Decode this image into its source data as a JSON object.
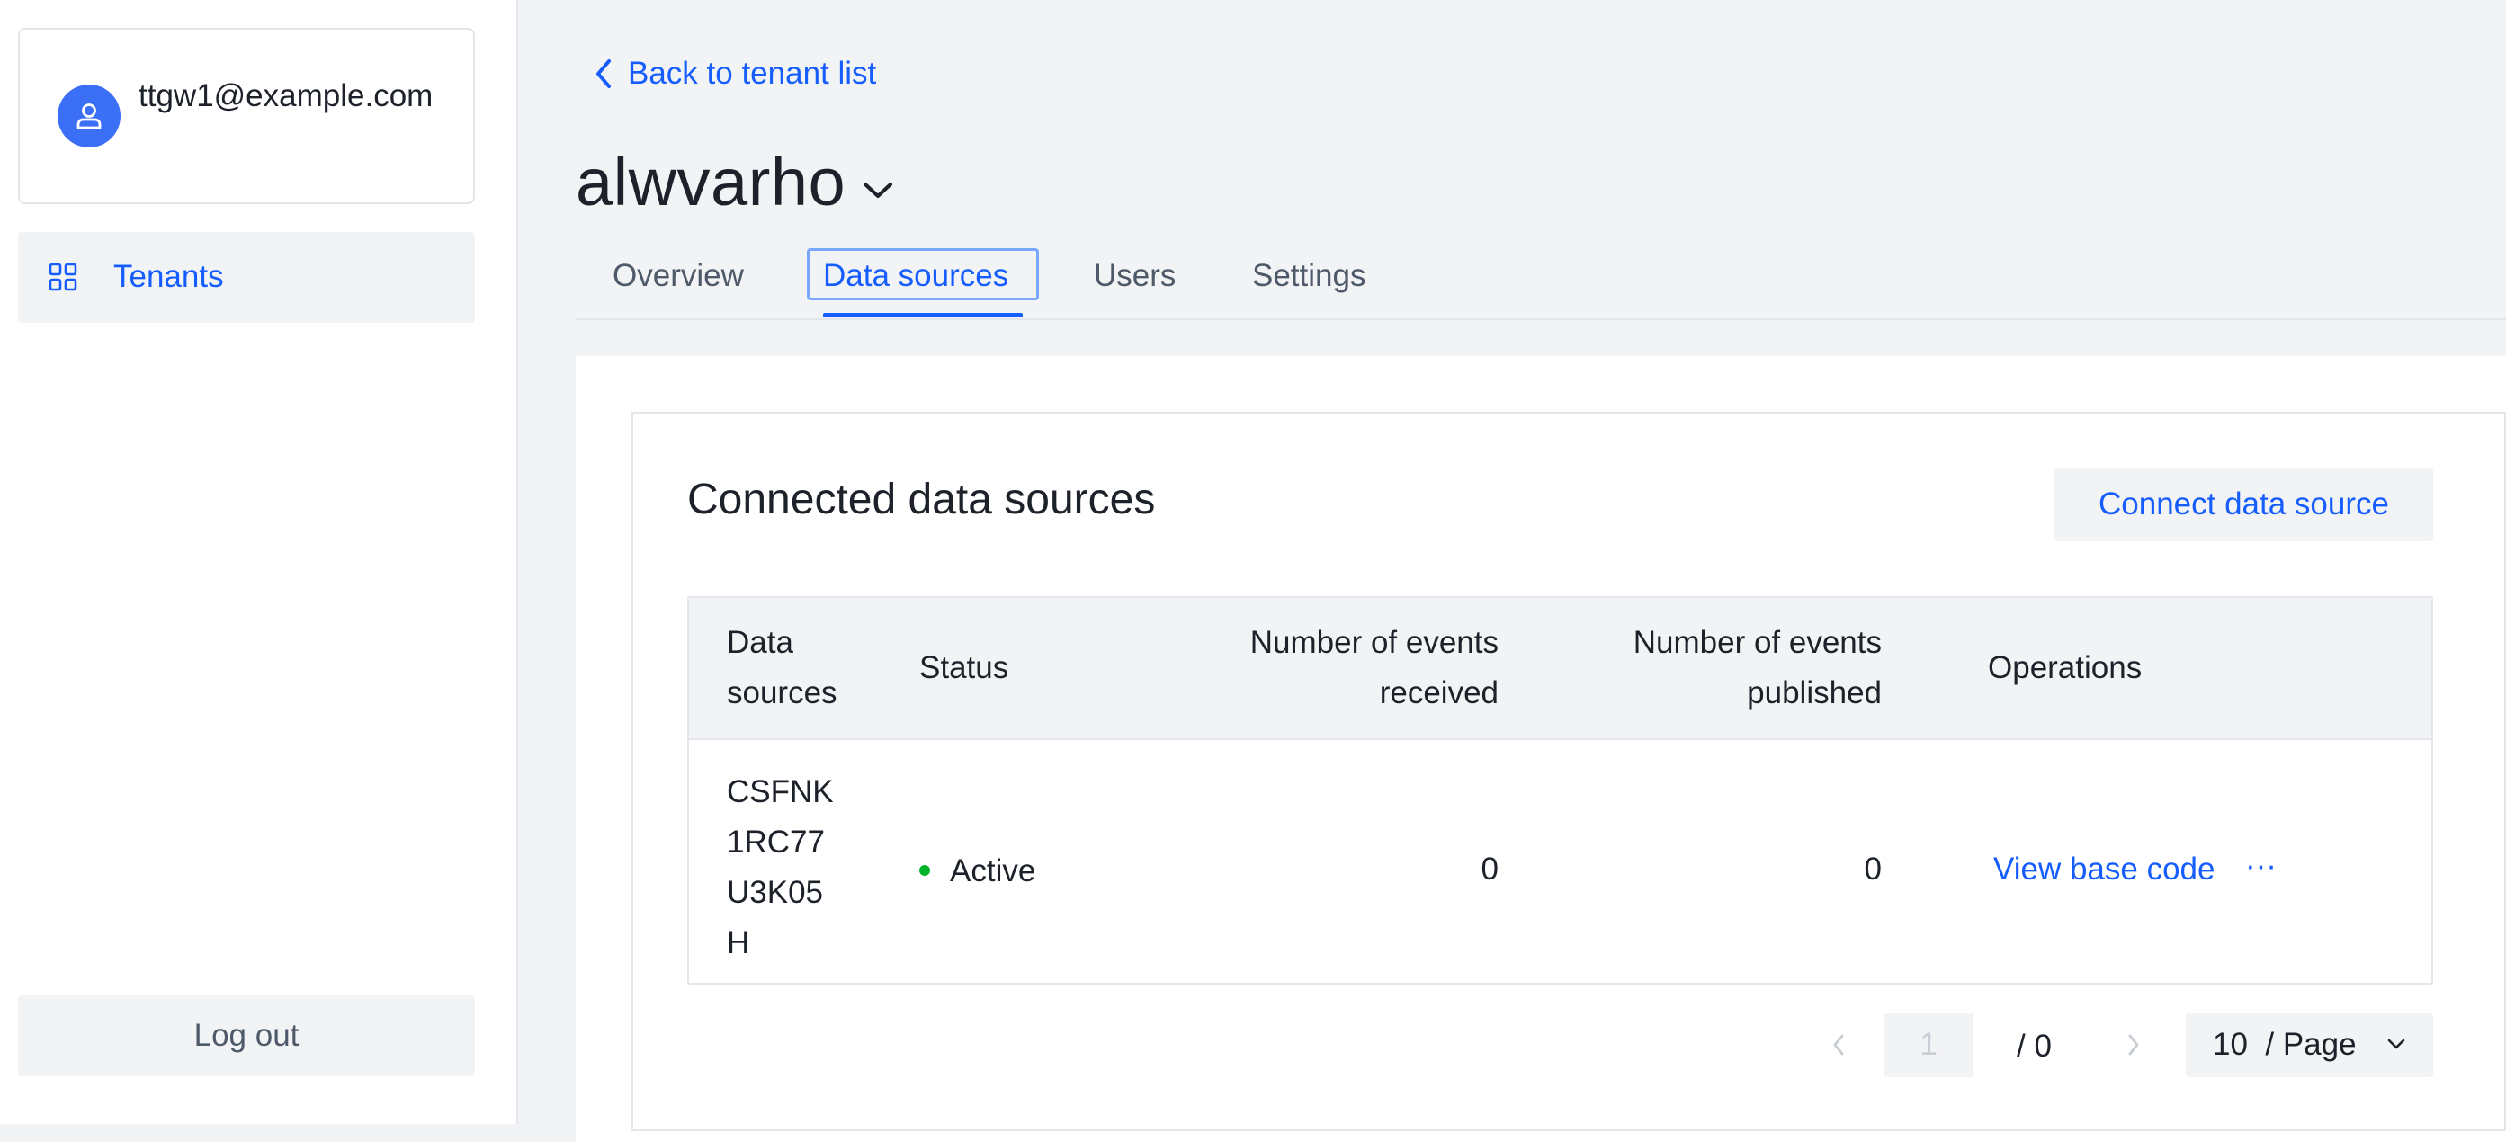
{
  "sidebar": {
    "user_email": "ttgw1@example.com",
    "nav_items": [
      {
        "label": "Tenants",
        "icon": "grid-icon"
      }
    ],
    "logout_label": "Log out"
  },
  "header": {
    "back_label": "Back to tenant list",
    "tenant_name": "alwvarho"
  },
  "tabs": [
    {
      "label": "Overview"
    },
    {
      "label": "Data sources",
      "active": true
    },
    {
      "label": "Users"
    },
    {
      "label": "Settings"
    }
  ],
  "card": {
    "title": "Connected data sources",
    "connect_label": "Connect data source"
  },
  "table": {
    "columns": [
      "Data sources",
      "Status",
      "Number of events received",
      "Number of events published",
      "Operations"
    ],
    "rows": [
      {
        "data_source": "CSFNK1RC77U3K05H",
        "status": "Active",
        "events_received": "0",
        "events_published": "0",
        "operation_link": "View base code",
        "operation_more": "···"
      }
    ]
  },
  "pagination": {
    "current_page": "1",
    "total_pages": "/  0",
    "page_size": "10  / Page"
  },
  "colors": {
    "accent": "#165dff",
    "status_active": "#00b42a",
    "avatar": "#3b6ff5"
  }
}
